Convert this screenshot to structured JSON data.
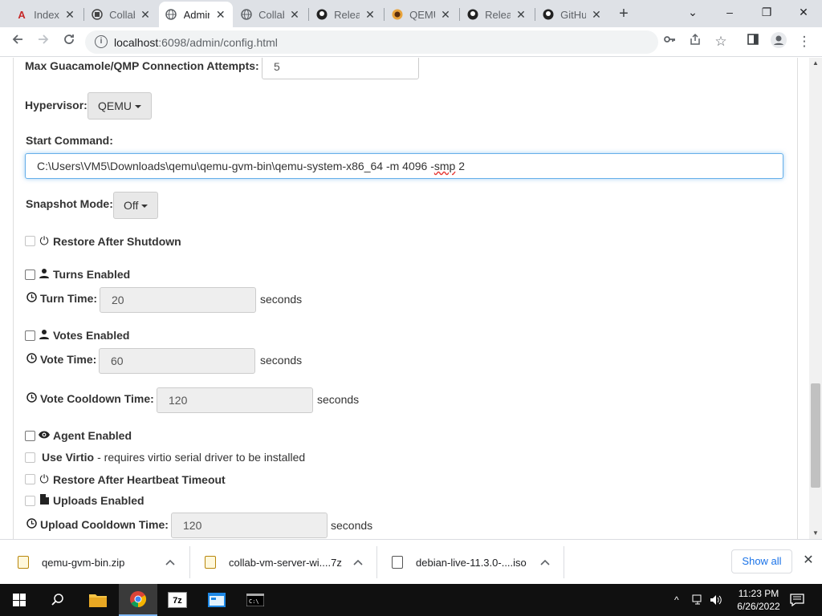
{
  "tabs": [
    {
      "title": "Index",
      "icon": "arch-icon"
    },
    {
      "title": "Collab",
      "icon": "collab-icon"
    },
    {
      "title": "Admin",
      "icon": "globe-icon",
      "active": true
    },
    {
      "title": "Collab",
      "icon": "globe-icon"
    },
    {
      "title": "Releases",
      "icon": "github-icon"
    },
    {
      "title": "QEMU",
      "icon": "qemu-icon"
    },
    {
      "title": "Releases",
      "icon": "github-icon"
    },
    {
      "title": "GitHub",
      "icon": "github-icon"
    }
  ],
  "window_controls": {
    "tab_search": "⌄",
    "minimize": "–",
    "maximize": "❐",
    "close": "✕"
  },
  "toolbar": {
    "url_host": "localhost",
    "url_path": ":6098/admin/config.html"
  },
  "form": {
    "max_attempts_label": "Max Guacamole/QMP Connection Attempts:",
    "max_attempts_value": "5",
    "hypervisor_label": "Hypervisor:",
    "hypervisor_value": "QEMU",
    "start_command_label": "Start Command:",
    "start_command_value_a": "C:\\Users\\VM5\\Downloads\\qemu\\qemu-gvm-bin\\qemu-system-x86_64 -m 4096 -",
    "start_command_value_b": "smp",
    "start_command_value_c": " 2",
    "snapshot_label": "Snapshot Mode:",
    "snapshot_value": "Off",
    "restore_shutdown_label": "Restore After Shutdown",
    "turns_enabled_label": "Turns Enabled",
    "turn_time_label": "Turn Time:",
    "turn_time_value": "20",
    "votes_enabled_label": "Votes Enabled",
    "vote_time_label": "Vote Time:",
    "vote_time_value": "60",
    "vote_cooldown_label": "Vote Cooldown Time:",
    "vote_cooldown_value": "120",
    "agent_enabled_label": "Agent Enabled",
    "use_virtio_label": "Use Virtio",
    "use_virtio_note": "- requires virtio serial driver to be installed",
    "restore_heartbeat_label": "Restore After Heartbeat Timeout",
    "uploads_enabled_label": "Uploads Enabled",
    "upload_cooldown_label": "Upload Cooldown Time:",
    "upload_cooldown_value": "120",
    "seconds_unit": "seconds"
  },
  "downloads": {
    "items": [
      {
        "name": "qemu-gvm-bin.zip",
        "icon": "zip-file-icon"
      },
      {
        "name": "collab-vm-server-wi....7z",
        "icon": "zip-file-icon"
      },
      {
        "name": "debian-live-11.3.0-....iso",
        "icon": "disc-file-icon"
      }
    ],
    "show_all": "Show all"
  },
  "taskbar": {
    "time": "11:23 PM",
    "date": "6/26/2022"
  }
}
